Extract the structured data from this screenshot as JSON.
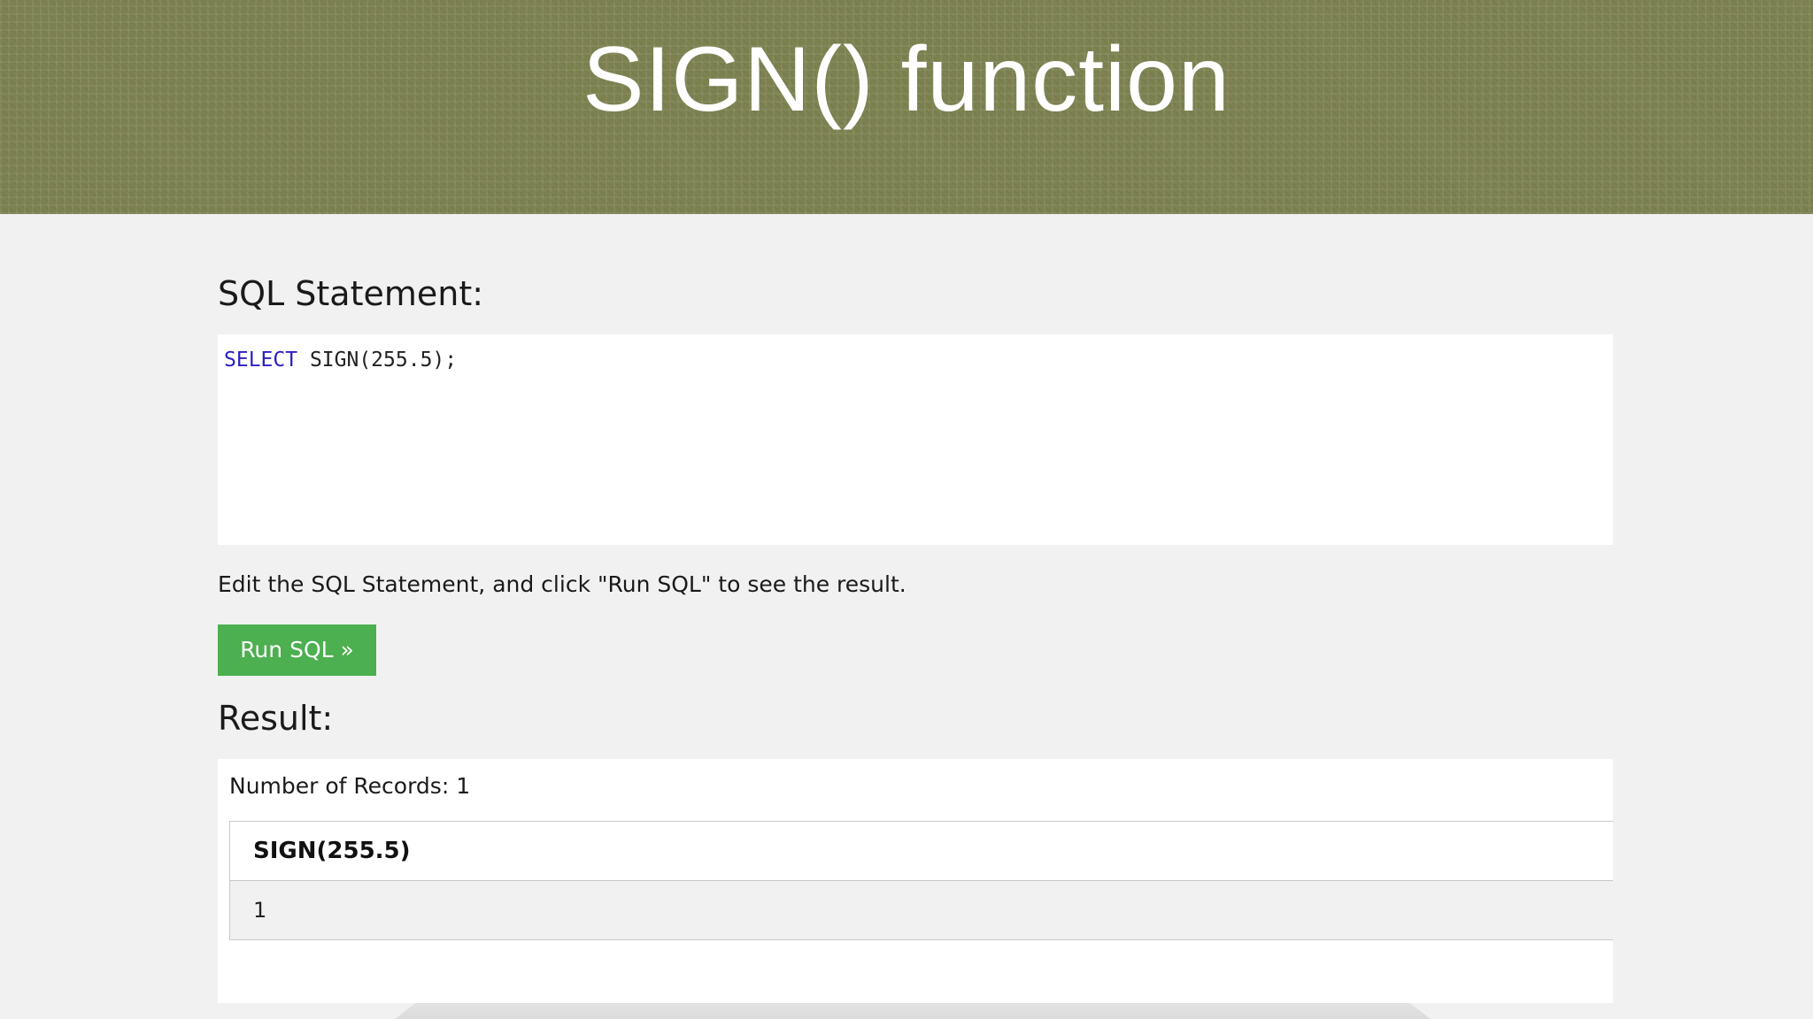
{
  "banner": {
    "title": "SIGN() function"
  },
  "sql": {
    "heading": "SQL Statement:",
    "keyword": "SELECT",
    "code_rest": " SIGN(255.5);",
    "hint": "Edit the SQL Statement, and click \"Run SQL\" to see the result.",
    "run_label": "Run SQL »"
  },
  "result": {
    "heading": "Result:",
    "records": "Number of Records: 1",
    "columns": [
      "SIGN(255.5)"
    ],
    "rows": [
      [
        "1"
      ]
    ]
  },
  "colors": {
    "banner": "#7c8150",
    "button": "#4caf50",
    "keyword": "#2a1fc4"
  }
}
